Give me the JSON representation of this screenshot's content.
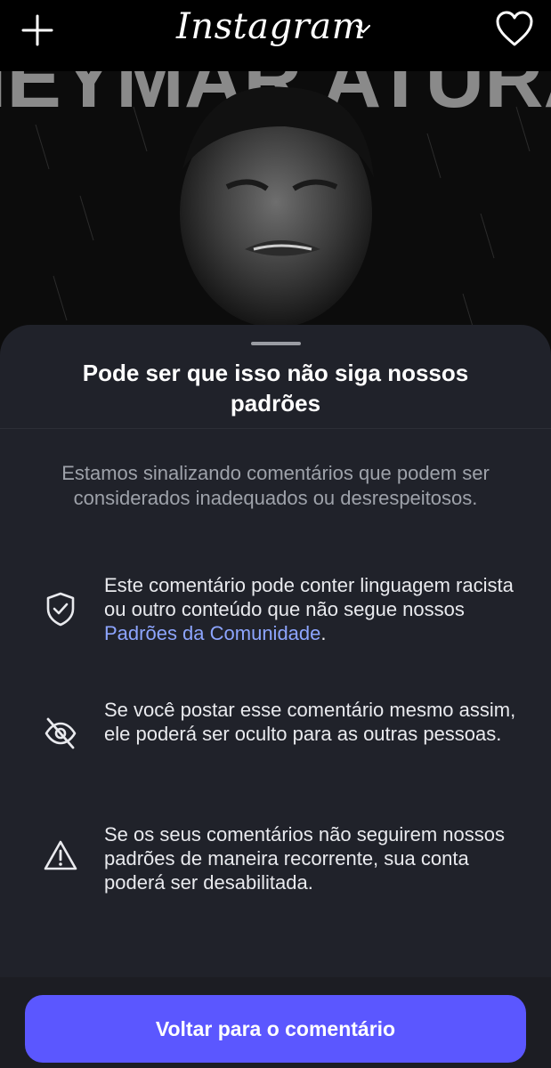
{
  "topbar": {
    "brand": "Instagram",
    "left_icon": "plus-icon",
    "dropdown_icon": "chevron-down-icon",
    "right_icon": "heart-icon"
  },
  "post": {
    "overlay_text": "NEYMAR ATURA"
  },
  "sheet": {
    "title": "Pode ser que isso não siga nossos padrões",
    "subtitle": "Estamos sinalizando comentários que podem ser considerados inadequados ou desrespeitosos.",
    "items": [
      {
        "icon": "shield-check-icon",
        "text_before": "Este comentário pode conter linguagem racista ou outro conteúdo que não segue nossos ",
        "link": "Padrões da Comunidade",
        "text_after": "."
      },
      {
        "icon": "eye-slash-icon",
        "text": "Se você postar esse comentário mesmo assim, ele poderá ser oculto para as outras pessoas."
      },
      {
        "icon": "warning-icon",
        "text": "Se os seus comentários não seguirem nossos padrões de maneira recorrente, sua conta poderá ser desabilitada."
      }
    ],
    "button_label": "Voltar para o comentário"
  },
  "colors": {
    "sheet_background": "#20222a",
    "button": "#5b57ff",
    "link": "#8da5ff"
  }
}
